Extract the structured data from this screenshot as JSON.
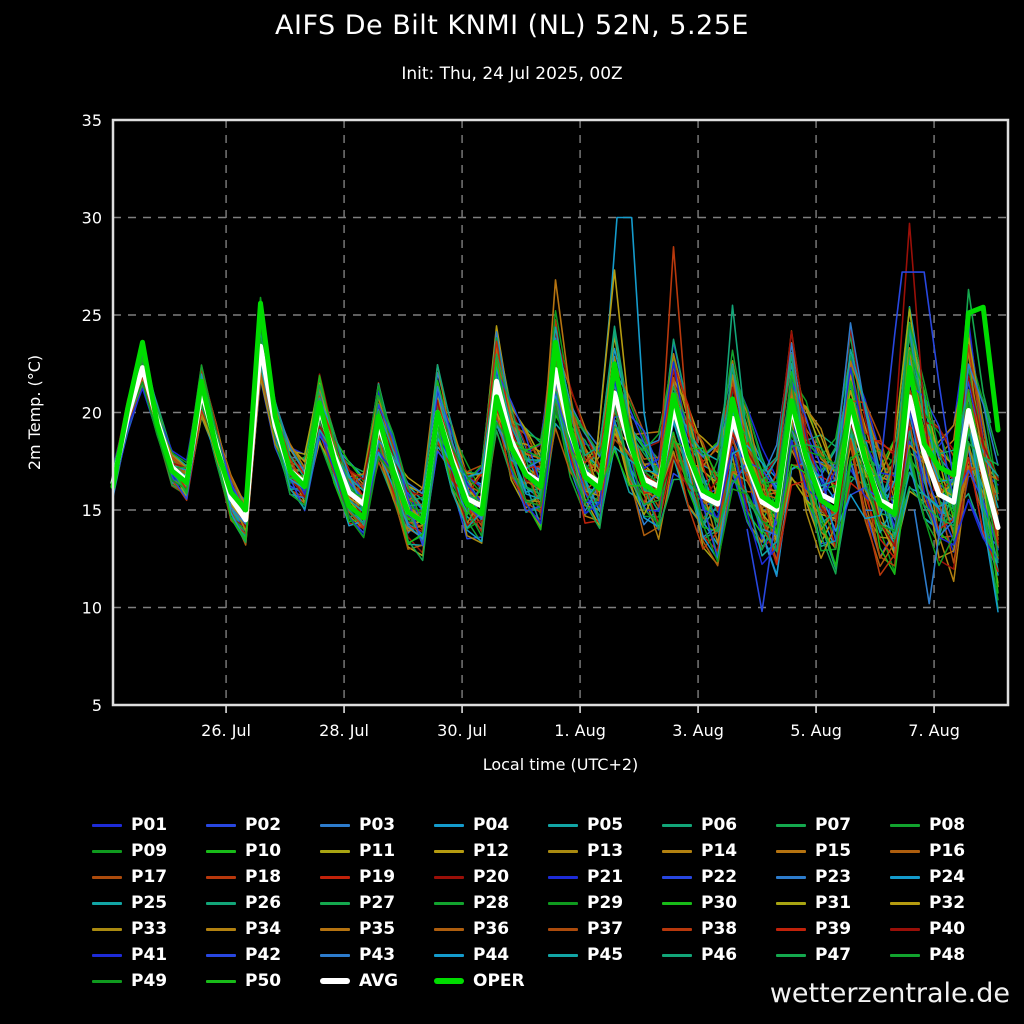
{
  "header": {
    "title": "AIFS De Bilt KNMI (NL) 52N, 5.25E",
    "subtitle": "Init: Thu, 24 Jul 2025, 00Z"
  },
  "footer": {
    "watermark": "wetterzentrale.de"
  },
  "chart_data": {
    "type": "line",
    "title": "AIFS De Bilt KNMI (NL) 52N, 5.25E",
    "subtitle": "Init: Thu, 24 Jul 2025, 00Z",
    "xlabel": "Local time (UTC+2)",
    "ylabel": "2m Temp. (°C)",
    "ylim": [
      5,
      35
    ],
    "yticks": [
      5,
      10,
      15,
      20,
      25,
      30,
      35
    ],
    "grid": "dashed",
    "legend_position": "below",
    "time_step_hours": 6,
    "forecast_hours": [
      0,
      360
    ],
    "xticks": [
      {
        "hour": 46,
        "label": "26. Jul"
      },
      {
        "hour": 94,
        "label": "28. Jul"
      },
      {
        "hour": 142,
        "label": "30. Jul"
      },
      {
        "hour": 190,
        "label": "1. Aug"
      },
      {
        "hour": 238,
        "label": "3. Aug"
      },
      {
        "hour": 286,
        "label": "5. Aug"
      },
      {
        "hour": 334,
        "label": "7. Aug"
      }
    ],
    "palette": [
      "#1d2bd8",
      "#2847e0",
      "#2d7ccc",
      "#149bcc",
      "#12a5a5",
      "#12a578",
      "#14a84e",
      "#12a32e",
      "#0f9a1e",
      "#18bb18",
      "#a8a412",
      "#b59b10",
      "#a98a10",
      "#b28110",
      "#b57310",
      "#ae5e0e",
      "#ac4b0c",
      "#b8380c",
      "#c2220a",
      "#9a0f08"
    ],
    "avg": {
      "name": "AVG",
      "color": "#ffffff",
      "values": [
        16.4,
        19.8,
        22.3,
        19.6,
        17.2,
        16.5,
        21.1,
        18.4,
        15.6,
        14.5,
        23.4,
        19.3,
        17.0,
        16.4,
        20.2,
        17.8,
        15.9,
        15.3,
        19.4,
        17.2,
        14.9,
        14.4,
        20.0,
        17.6,
        15.6,
        15.2,
        21.6,
        18.6,
        16.9,
        16.4,
        22.2,
        19.0,
        16.9,
        16.4,
        21.0,
        18.4,
        16.6,
        16.2,
        20.2,
        17.8,
        15.7,
        15.3,
        19.7,
        17.4,
        15.4,
        15.0,
        20.3,
        17.6,
        15.8,
        15.4,
        20.0,
        17.5,
        15.5,
        15.1,
        20.8,
        17.9,
        15.8,
        15.4,
        20.1,
        17.0,
        14.1
      ]
    },
    "oper": {
      "name": "OPER",
      "color": "#00dc00",
      "values": [
        16.2,
        20.2,
        23.6,
        19.4,
        17.0,
        16.4,
        21.6,
        18.2,
        15.9,
        15.0,
        25.6,
        19.8,
        17.0,
        16.2,
        20.5,
        17.5,
        15.2,
        14.6,
        19.8,
        17.0,
        14.9,
        14.4,
        20.0,
        17.4,
        15.3,
        14.8,
        20.8,
        18.2,
        16.8,
        16.2,
        23.6,
        19.2,
        16.7,
        16.1,
        22.5,
        18.6,
        16.3,
        15.8,
        20.9,
        17.9,
        16.0,
        15.6,
        20.7,
        17.6,
        15.7,
        15.2,
        20.6,
        17.7,
        15.5,
        15.0,
        20.6,
        17.6,
        15.3,
        14.8,
        22.3,
        18.4,
        17.2,
        16.8,
        25.1,
        25.4,
        19.1
      ]
    },
    "ensemble_spread": [
      0.7,
      0.8,
      1.0,
      0.8,
      0.9,
      1.0,
      1.3,
      1.0,
      1.1,
      1.2,
      1.6,
      1.2,
      1.4,
      1.4,
      1.8,
      1.4,
      1.6,
      1.6,
      2.1,
      1.6,
      1.8,
      1.9,
      2.4,
      1.8,
      2.0,
      2.1,
      2.7,
      2.0,
      2.2,
      2.3,
      2.9,
      2.2,
      2.5,
      2.5,
      3.2,
      2.4,
      2.7,
      2.7,
      3.5,
      2.6,
      2.9,
      3.0,
      3.8,
      2.8,
      3.1,
      3.2,
      4.0,
      3.0,
      3.3,
      3.4,
      4.3,
      3.2,
      3.6,
      3.6,
      4.6,
      3.4,
      3.8,
      3.8,
      4.9,
      3.6,
      4.0
    ],
    "members": [
      {
        "name": "P01",
        "palette_index": 0
      },
      {
        "name": "P02",
        "palette_index": 1
      },
      {
        "name": "P03",
        "palette_index": 2
      },
      {
        "name": "P04",
        "palette_index": 3
      },
      {
        "name": "P05",
        "palette_index": 4
      },
      {
        "name": "P06",
        "palette_index": 5
      },
      {
        "name": "P07",
        "palette_index": 6
      },
      {
        "name": "P08",
        "palette_index": 7
      },
      {
        "name": "P09",
        "palette_index": 8
      },
      {
        "name": "P10",
        "palette_index": 9
      },
      {
        "name": "P11",
        "palette_index": 10
      },
      {
        "name": "P12",
        "palette_index": 11
      },
      {
        "name": "P13",
        "palette_index": 12
      },
      {
        "name": "P14",
        "palette_index": 13
      },
      {
        "name": "P15",
        "palette_index": 14
      },
      {
        "name": "P16",
        "palette_index": 15
      },
      {
        "name": "P17",
        "palette_index": 16
      },
      {
        "name": "P18",
        "palette_index": 17
      },
      {
        "name": "P19",
        "palette_index": 18
      },
      {
        "name": "P20",
        "palette_index": 19
      },
      {
        "name": "P21",
        "palette_index": 0
      },
      {
        "name": "P22",
        "palette_index": 1
      },
      {
        "name": "P23",
        "palette_index": 2
      },
      {
        "name": "P24",
        "palette_index": 3
      },
      {
        "name": "P25",
        "palette_index": 4
      },
      {
        "name": "P26",
        "palette_index": 5
      },
      {
        "name": "P27",
        "palette_index": 6
      },
      {
        "name": "P28",
        "palette_index": 7
      },
      {
        "name": "P29",
        "palette_index": 8
      },
      {
        "name": "P30",
        "palette_index": 9
      },
      {
        "name": "P31",
        "palette_index": 10
      },
      {
        "name": "P32",
        "palette_index": 11
      },
      {
        "name": "P33",
        "palette_index": 12
      },
      {
        "name": "P34",
        "palette_index": 13
      },
      {
        "name": "P35",
        "palette_index": 14
      },
      {
        "name": "P36",
        "palette_index": 15
      },
      {
        "name": "P37",
        "palette_index": 16
      },
      {
        "name": "P38",
        "palette_index": 17
      },
      {
        "name": "P39",
        "palette_index": 18
      },
      {
        "name": "P40",
        "palette_index": 19
      },
      {
        "name": "P41",
        "palette_index": 0
      },
      {
        "name": "P42",
        "palette_index": 1
      },
      {
        "name": "P43",
        "palette_index": 2
      },
      {
        "name": "P44",
        "palette_index": 3
      },
      {
        "name": "P45",
        "palette_index": 4
      },
      {
        "name": "P46",
        "palette_index": 5
      },
      {
        "name": "P47",
        "palette_index": 6
      },
      {
        "name": "P48",
        "palette_index": 7
      },
      {
        "name": "P49",
        "palette_index": 8
      },
      {
        "name": "P50",
        "palette_index": 9
      }
    ],
    "outlier_excursions": [
      {
        "palette_index": 3,
        "points": [
          [
            196,
            17.0
          ],
          [
            202,
            25.0
          ],
          [
            205,
            30.0
          ],
          [
            211,
            30.0
          ],
          [
            216,
            20.0
          ],
          [
            220,
            17.0
          ]
        ]
      },
      {
        "palette_index": 14,
        "points": [
          [
            174,
            16.5
          ],
          [
            180,
            26.8
          ],
          [
            186,
            21.0
          ],
          [
            189,
            18.0
          ]
        ]
      },
      {
        "palette_index": 11,
        "points": [
          [
            196,
            17.0
          ],
          [
            204,
            27.3
          ],
          [
            210,
            20.0
          ],
          [
            214,
            17.5
          ]
        ]
      },
      {
        "palette_index": 17,
        "points": [
          [
            222,
            16.5
          ],
          [
            228,
            28.5
          ],
          [
            234,
            19.0
          ],
          [
            238,
            16.5
          ]
        ]
      },
      {
        "palette_index": 19,
        "points": [
          [
            316,
            15.5
          ],
          [
            324,
            29.7
          ],
          [
            330,
            20.0
          ],
          [
            334,
            16.0
          ]
        ]
      },
      {
        "palette_index": 1,
        "points": [
          [
            312,
            17.0
          ],
          [
            318,
            24.0
          ],
          [
            321,
            27.2
          ],
          [
            330,
            27.2
          ],
          [
            336,
            21.5
          ],
          [
            342,
            16.5
          ]
        ]
      },
      {
        "palette_index": 8,
        "points": [
          [
            54,
            15.2
          ],
          [
            60,
            25.9
          ],
          [
            66,
            19.5
          ]
        ]
      },
      {
        "palette_index": 5,
        "points": [
          [
            246,
            16.0
          ],
          [
            252,
            25.5
          ],
          [
            258,
            18.5
          ]
        ]
      },
      {
        "palette_index": 6,
        "points": [
          [
            342,
            16.5
          ],
          [
            348,
            26.3
          ],
          [
            354,
            21.0
          ],
          [
            357,
            19.5
          ]
        ]
      },
      {
        "palette_index": 1,
        "points": [
          [
            258,
            14.0
          ],
          [
            264,
            9.8
          ],
          [
            270,
            15.0
          ]
        ]
      },
      {
        "palette_index": 2,
        "points": [
          [
            326,
            15.0
          ],
          [
            332,
            10.2
          ],
          [
            338,
            15.5
          ]
        ]
      }
    ]
  },
  "legend": {
    "columns": 8
  }
}
